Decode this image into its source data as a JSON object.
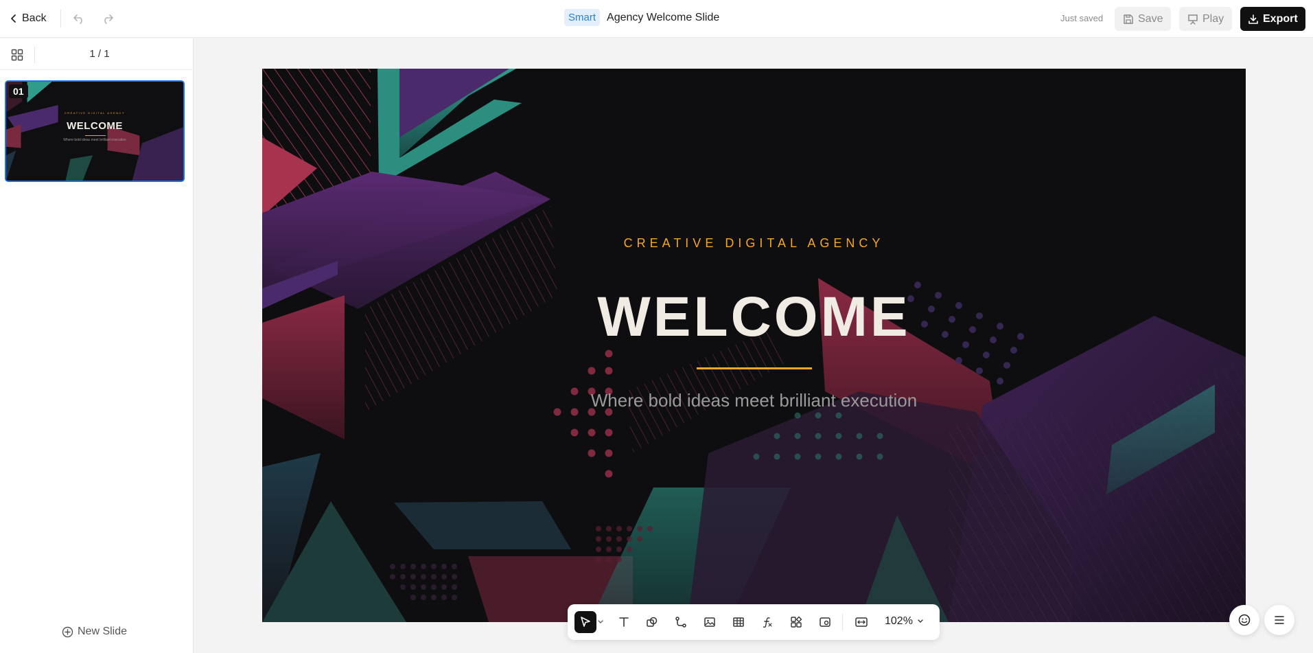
{
  "header": {
    "back_label": "Back",
    "badge": "Smart",
    "title": "Agency Welcome Slide",
    "status": "Just saved",
    "save_label": "Save",
    "play_label": "Play",
    "export_label": "Export"
  },
  "sidebar": {
    "page_indicator": "1 / 1",
    "slides": [
      {
        "number": "01",
        "kicker": "CREATIVE DIGITAL AGENCY",
        "title": "WELCOME",
        "subtitle": "Where bold ideas meet brilliant execution"
      }
    ],
    "new_slide_label": "New Slide"
  },
  "slide": {
    "kicker": "CREATIVE DIGITAL AGENCY",
    "title": "WELCOME",
    "subtitle": "Where bold ideas meet brilliant execution",
    "colors": {
      "background": "#0f0f12",
      "accent": "#f5a623",
      "title": "#f1ece3",
      "subtitle": "#9a9a9a",
      "teal": "#2f9c8c",
      "purple": "#4a2a6a",
      "red": "#7a2a3e"
    }
  },
  "toolbar": {
    "tools": [
      "select-tool",
      "text-tool",
      "shapes-tool",
      "connector-tool",
      "image-tool",
      "table-tool",
      "formula-tool",
      "components-tool",
      "media-tool",
      "fit-tool"
    ],
    "zoom": "102%"
  },
  "colors": {
    "accent_blue": "#1a73e8",
    "export_bg": "#111111"
  }
}
